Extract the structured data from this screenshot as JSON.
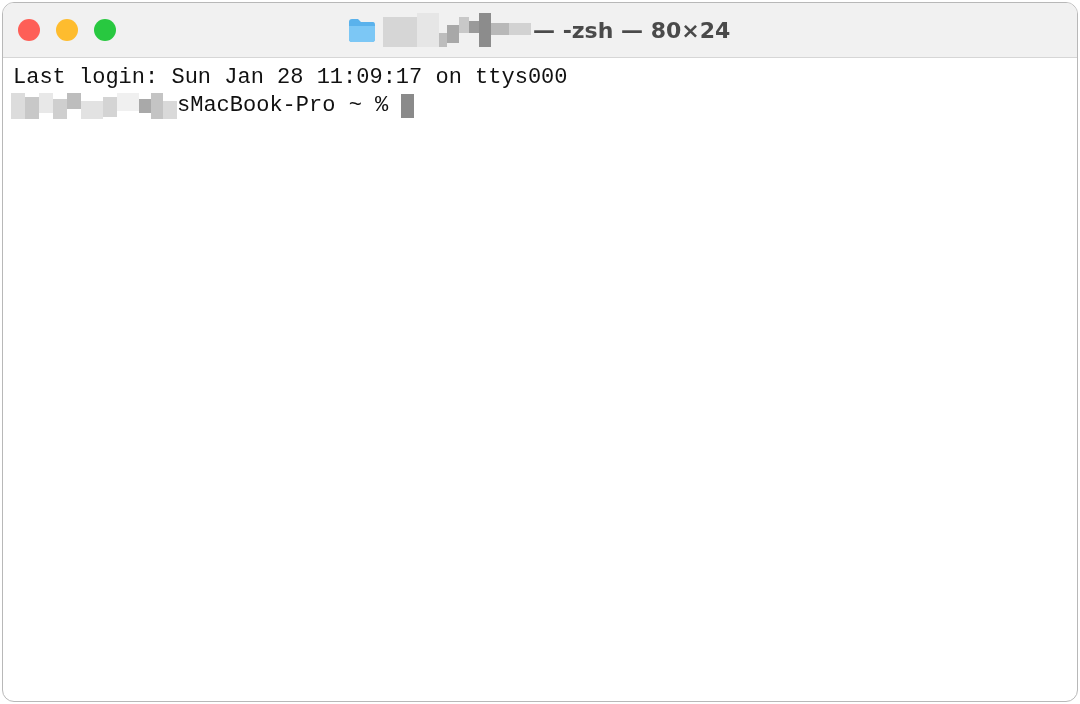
{
  "window": {
    "title": "— -zsh — 80×24"
  },
  "lines": [
    {
      "kind": "output",
      "text": "Last login: Sun Jan 28 11:09:17 on ttys000"
    },
    {
      "kind": "prompt",
      "text": "sMacBook-Pro ~ %"
    }
  ]
}
